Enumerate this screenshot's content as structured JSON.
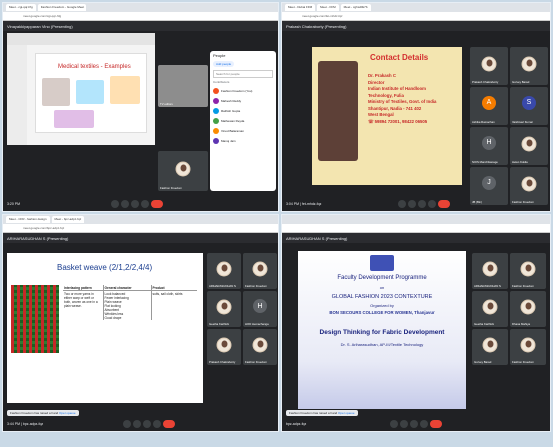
{
  "q1": {
    "tabs": [
      "Meet - cgi-qqr-hfg",
      "Fashion Freedom - Google Meet"
    ],
    "url": "meet.google.com/cgi-qqr-hfg",
    "presenter": "Vinayakkiyapparan Vino (Presenting)",
    "slide_title": "Medical textiles - Examples",
    "tiles": [
      {
        "name": "TV editors"
      },
      {
        "name": "Fashion Freedom"
      }
    ],
    "people_panel": {
      "title": "People",
      "add": "Add people",
      "search": "Search for people",
      "section": "Contributors",
      "items": [
        "Fashion Freedom (You)",
        "Mahesh Reddy",
        "Rathish Gupta",
        "Mathewan Reyda",
        "Vinod Balaraman",
        "Manoj Jain"
      ]
    },
    "time": "3:20 PM"
  },
  "q2": {
    "tabs": [
      "Meet - Dubai FFM",
      "Meet - FFM",
      "Meet - cghsd0k7b"
    ],
    "url": "meet.google.com/fet-mhdz-fqz",
    "presenter": "Prakash Chakraborty (Presenting)",
    "slide_heading": "Contact Details",
    "slide_lines": [
      "Dr. Prakash C",
      "Director",
      "Indian Institute of Handloom",
      "Technology, Fulia",
      "Ministry of Textiles, Govt. of India",
      "Shantipur, Nadia - 741 402",
      "West Bengal",
      "☏ 59894 72001, 98422 06505"
    ],
    "tiles": [
      {
        "name": "Prakash Chakraborty",
        "letter": "",
        "color": "#6d4c41"
      },
      {
        "name": "Gurvey Barad",
        "letter": "",
        "color": "#5f6368"
      },
      {
        "name": "Ashika Ramachan",
        "letter": "A",
        "color": "#f57c00"
      },
      {
        "name": "Vaishnavi Kumar",
        "letter": "S",
        "color": "#3949ab"
      },
      {
        "name": "NIOS Manchikanage",
        "letter": "H",
        "color": "#5f6368"
      },
      {
        "name": "Helen Kokila",
        "letter": "",
        "color": "#5f6368"
      },
      {
        "name": "JB (Bin)",
        "letter": "J",
        "color": "#5f6368"
      },
      {
        "name": "Fashion Freedom",
        "letter": "",
        "color": "#5f6368"
      }
    ],
    "time": "3:04 PM",
    "meeting": "fet-mhdz-fqz"
  },
  "q3": {
    "tabs": [
      "Meet - CFR - fashion design",
      "Meet - bpz-adpz-fqz"
    ],
    "url": "meet.google.com/bpz-adpz-fqz",
    "presenter": "ARIHARASUDHAN S (Presenting)",
    "slide_title": "Basket weave (2/1,2/2,4/4)",
    "table_headers": [
      "Interlacing pattern",
      "General character",
      "Product"
    ],
    "table_col1": "Two or more yarns in either warp or weft or both, woven as one in a plain weave.",
    "table_col2": [
      "Look balanced",
      "Fewer interlacing",
      "Plain weave",
      "Flat looking",
      "Absorbent",
      "Wrinkles less",
      "Good drape"
    ],
    "table_col3": "suits, sail cloth, skirts",
    "tiles": [
      {
        "name": "ARIHARASUDHAN S",
        "letter": "",
        "color": "#5f6368"
      },
      {
        "name": "Fashion Freedom",
        "letter": "",
        "color": "#5f6368"
      },
      {
        "name": "Geetha Karthick",
        "letter": "",
        "color": "#5f6368"
      },
      {
        "name": "HOD Hemachanga",
        "letter": "H",
        "color": "#5f6368"
      },
      {
        "name": "Prakash Chakraborty",
        "letter": "",
        "color": "#5f6368"
      },
      {
        "name": "Fashion Freedom",
        "letter": "",
        "color": "#5f6368"
      }
    ],
    "toast": "Fashion Freedom has raised a hand",
    "toast_action": "Open queue",
    "time": "3:44 PM",
    "meeting": "bpz-adpz-fqz"
  },
  "q4": {
    "presenter": "ARIHARASUDHAN S (Presenting)",
    "lines": [
      "Faculty Development Programme",
      "on",
      "GLOBAL FASHION 2023 CONTEXTURE",
      "Organized by",
      "BON SECOURS COLLEGE FOR WOMEN, Thanjavur",
      "Design Thinking for Fabric Development",
      "Dr. S. Ariharasudhan, AP-III/Textile Technology"
    ],
    "tiles": [
      {
        "name": "ARIHARASUDHAN S",
        "letter": "",
        "color": "#5f6368"
      },
      {
        "name": "Fashion Freedom",
        "letter": "",
        "color": "#5f6368"
      },
      {
        "name": "Geetha Karthick",
        "letter": "",
        "color": "#5f6368"
      },
      {
        "name": "Dhana Mahiya",
        "letter": "",
        "color": "#5f6368"
      },
      {
        "name": "Gurvey Barad",
        "letter": "",
        "color": "#5f6368"
      },
      {
        "name": "Fashion Freedom",
        "letter": "",
        "color": "#5f6368"
      }
    ],
    "toast": "Fashion Freedom has raised a hand",
    "toast_action": "Open queue",
    "meeting": "bpz-adpz-fqz"
  }
}
